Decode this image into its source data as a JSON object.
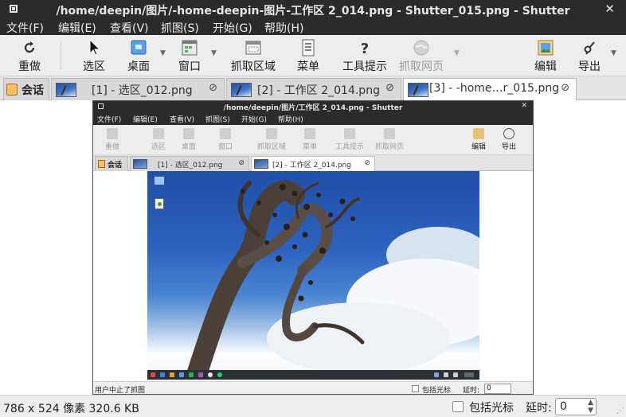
{
  "window": {
    "title": "/home/deepin/图片/-home-deepin-图片-工作区 2_014.png - Shutter_015.png - Shutter",
    "close_glyph": "✕"
  },
  "menubar": [
    "文件(F)",
    "编辑(E)",
    "查看(V)",
    "抓图(S)",
    "开始(G)",
    "帮助(H)"
  ],
  "toolbar": {
    "redo": "重做",
    "selection": "选区",
    "desktop": "桌面",
    "window": "窗口",
    "region": "抓取区域",
    "menu": "菜单",
    "tooltip": "工具提示",
    "web": "抓取网页",
    "edit": "编辑",
    "export": "导出"
  },
  "tabs": {
    "session": "会话",
    "items": [
      {
        "label": "[1] - 选区_012.png",
        "close": "⊘"
      },
      {
        "label": "[2] - 工作区 2_014.png",
        "close": "⊘"
      },
      {
        "label": "[3] - -home…r_015.png",
        "close": "⊘"
      }
    ]
  },
  "inner": {
    "title": "/home/deepin/图片/工作区 2_014.png - Shutter",
    "close_glyph": "✕",
    "menubar": [
      "文件(F)",
      "编辑(E)",
      "查看(V)",
      "抓图(S)",
      "开始(G)",
      "帮助(H)"
    ],
    "toolbar": [
      "重做",
      "选区",
      "桌面",
      "窗口",
      "抓取区域",
      "菜单",
      "工具提示",
      "抓取网页",
      "编辑",
      "导出"
    ],
    "session": "会话",
    "tabs": [
      {
        "label": "[1] - 选区_012.png",
        "close": "⊘"
      },
      {
        "label": "[2] - 工作区 2_014.png",
        "close": "⊘"
      }
    ],
    "status": "用户中止了抓图",
    "cursor_checkbox": "包括光标",
    "delay_label": "延时:",
    "delay_value": "0"
  },
  "statusbar": {
    "info": "786 x 524 像素  320.6 KB",
    "cursor_checkbox": "包括光标",
    "delay_label": "延时:",
    "delay_value": "0"
  },
  "colors": {
    "titlebar_bg": "#2b2b2b",
    "toolbar_bg": "#ededed",
    "accent_blue": "#2d63bf"
  }
}
